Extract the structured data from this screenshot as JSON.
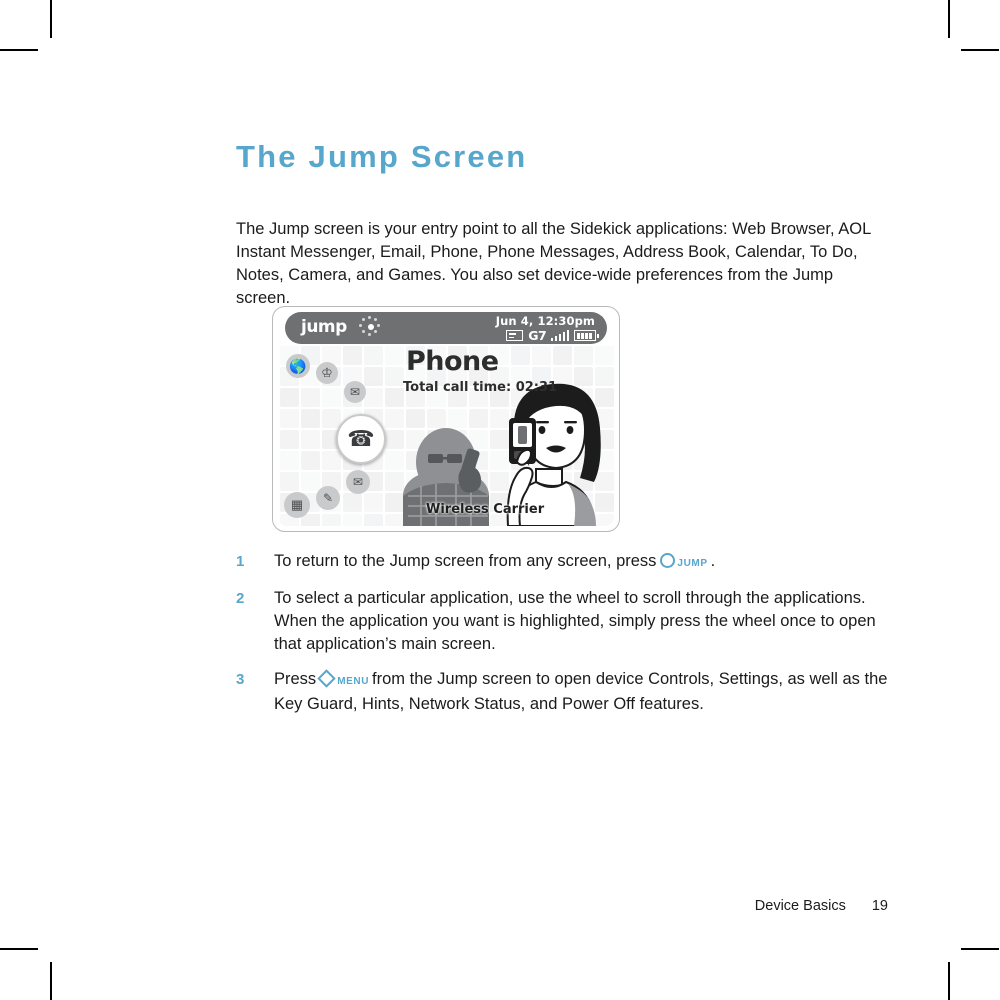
{
  "document": {
    "title": "The Jump Screen",
    "intro": "The Jump screen is your entry point to all the Sidekick applications: Web Browser, AOL Instant Messenger, Email, Phone, Phone Messages, Address Book, Calendar, To Do, Notes, Camera, and Games. You also set device-wide preferences from the Jump screen."
  },
  "colors": {
    "accent_blue": "#57A6CB",
    "body_text": "#1b1b1b",
    "statusbar_gray": "#6f7072",
    "grid_gray": "#e3e4e6",
    "icon_gray": "#c9cacc"
  },
  "device_figure": {
    "statusbar": {
      "logo": "jump",
      "datetime": "Jun 4, 12:30pm",
      "icons": [
        {
          "name": "envelope-icon",
          "label": "message"
        },
        {
          "name": "gprs-icon",
          "label": "G7"
        },
        {
          "name": "signal-icon",
          "label": "signal"
        },
        {
          "name": "battery-icon",
          "label": "battery"
        }
      ]
    },
    "screen": {
      "app_title": "Phone",
      "app_subtitle": "Total call time: 02:31",
      "carrier": "Wireless Carrier",
      "app_icons": [
        {
          "name": "web-browser-icon",
          "glyph": "⊕",
          "selected": false
        },
        {
          "name": "aim-icon",
          "glyph": "♟",
          "selected": false
        },
        {
          "name": "email-icon",
          "glyph": "✉",
          "selected": false
        },
        {
          "name": "phone-icon",
          "glyph": "☎",
          "selected": true
        },
        {
          "name": "phone-messages-icon",
          "glyph": "✉",
          "selected": false
        },
        {
          "name": "notes-icon",
          "glyph": "✎",
          "selected": false
        },
        {
          "name": "calendar-icon",
          "glyph": "▦",
          "selected": false
        }
      ]
    }
  },
  "steps": [
    {
      "number": "1",
      "text_before": "To return to the Jump screen from any screen, press",
      "key_icon": "circle-key-icon",
      "key_label": "JUMP",
      "text_after": "."
    },
    {
      "number": "2",
      "text_before": "To select a particular application, use the wheel to scroll through the applications. When the application you want is highlighted, simply press the wheel once to open that application’s main screen.",
      "key_icon": "",
      "key_label": "",
      "text_after": ""
    },
    {
      "number": "3",
      "text_before": "Press",
      "key_icon": "diamond-key-icon",
      "key_label": "MENU",
      "text_after": "from the Jump screen to open device Controls, Settings, as well as the Key Guard, Hints, Network Status, and Power Off features."
    }
  ],
  "footer": {
    "section": "Device Basics",
    "page_number": "19"
  }
}
